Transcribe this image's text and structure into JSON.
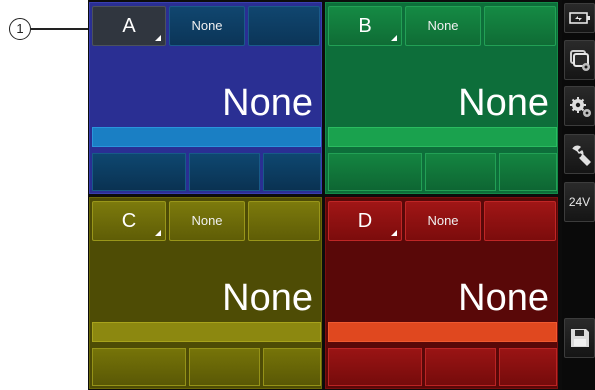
{
  "callout": {
    "number": "1"
  },
  "channels": [
    {
      "name": "A",
      "unit": "None",
      "value": "None",
      "color": "#2a2f93"
    },
    {
      "name": "B",
      "unit": "None",
      "value": "None",
      "color": "#0d6e3a"
    },
    {
      "name": "C",
      "unit": "None",
      "value": "None",
      "color": "#4e4c05"
    },
    {
      "name": "D",
      "unit": "None",
      "value": "None",
      "color": "#590808"
    }
  ],
  "sidebar": {
    "items": [
      {
        "icon": "battery-icon"
      },
      {
        "icon": "screen-settings-icon"
      },
      {
        "icon": "gears-icon"
      },
      {
        "icon": "wrench-icon"
      },
      {
        "label": "24V"
      },
      {
        "icon": "save-icon"
      }
    ]
  }
}
